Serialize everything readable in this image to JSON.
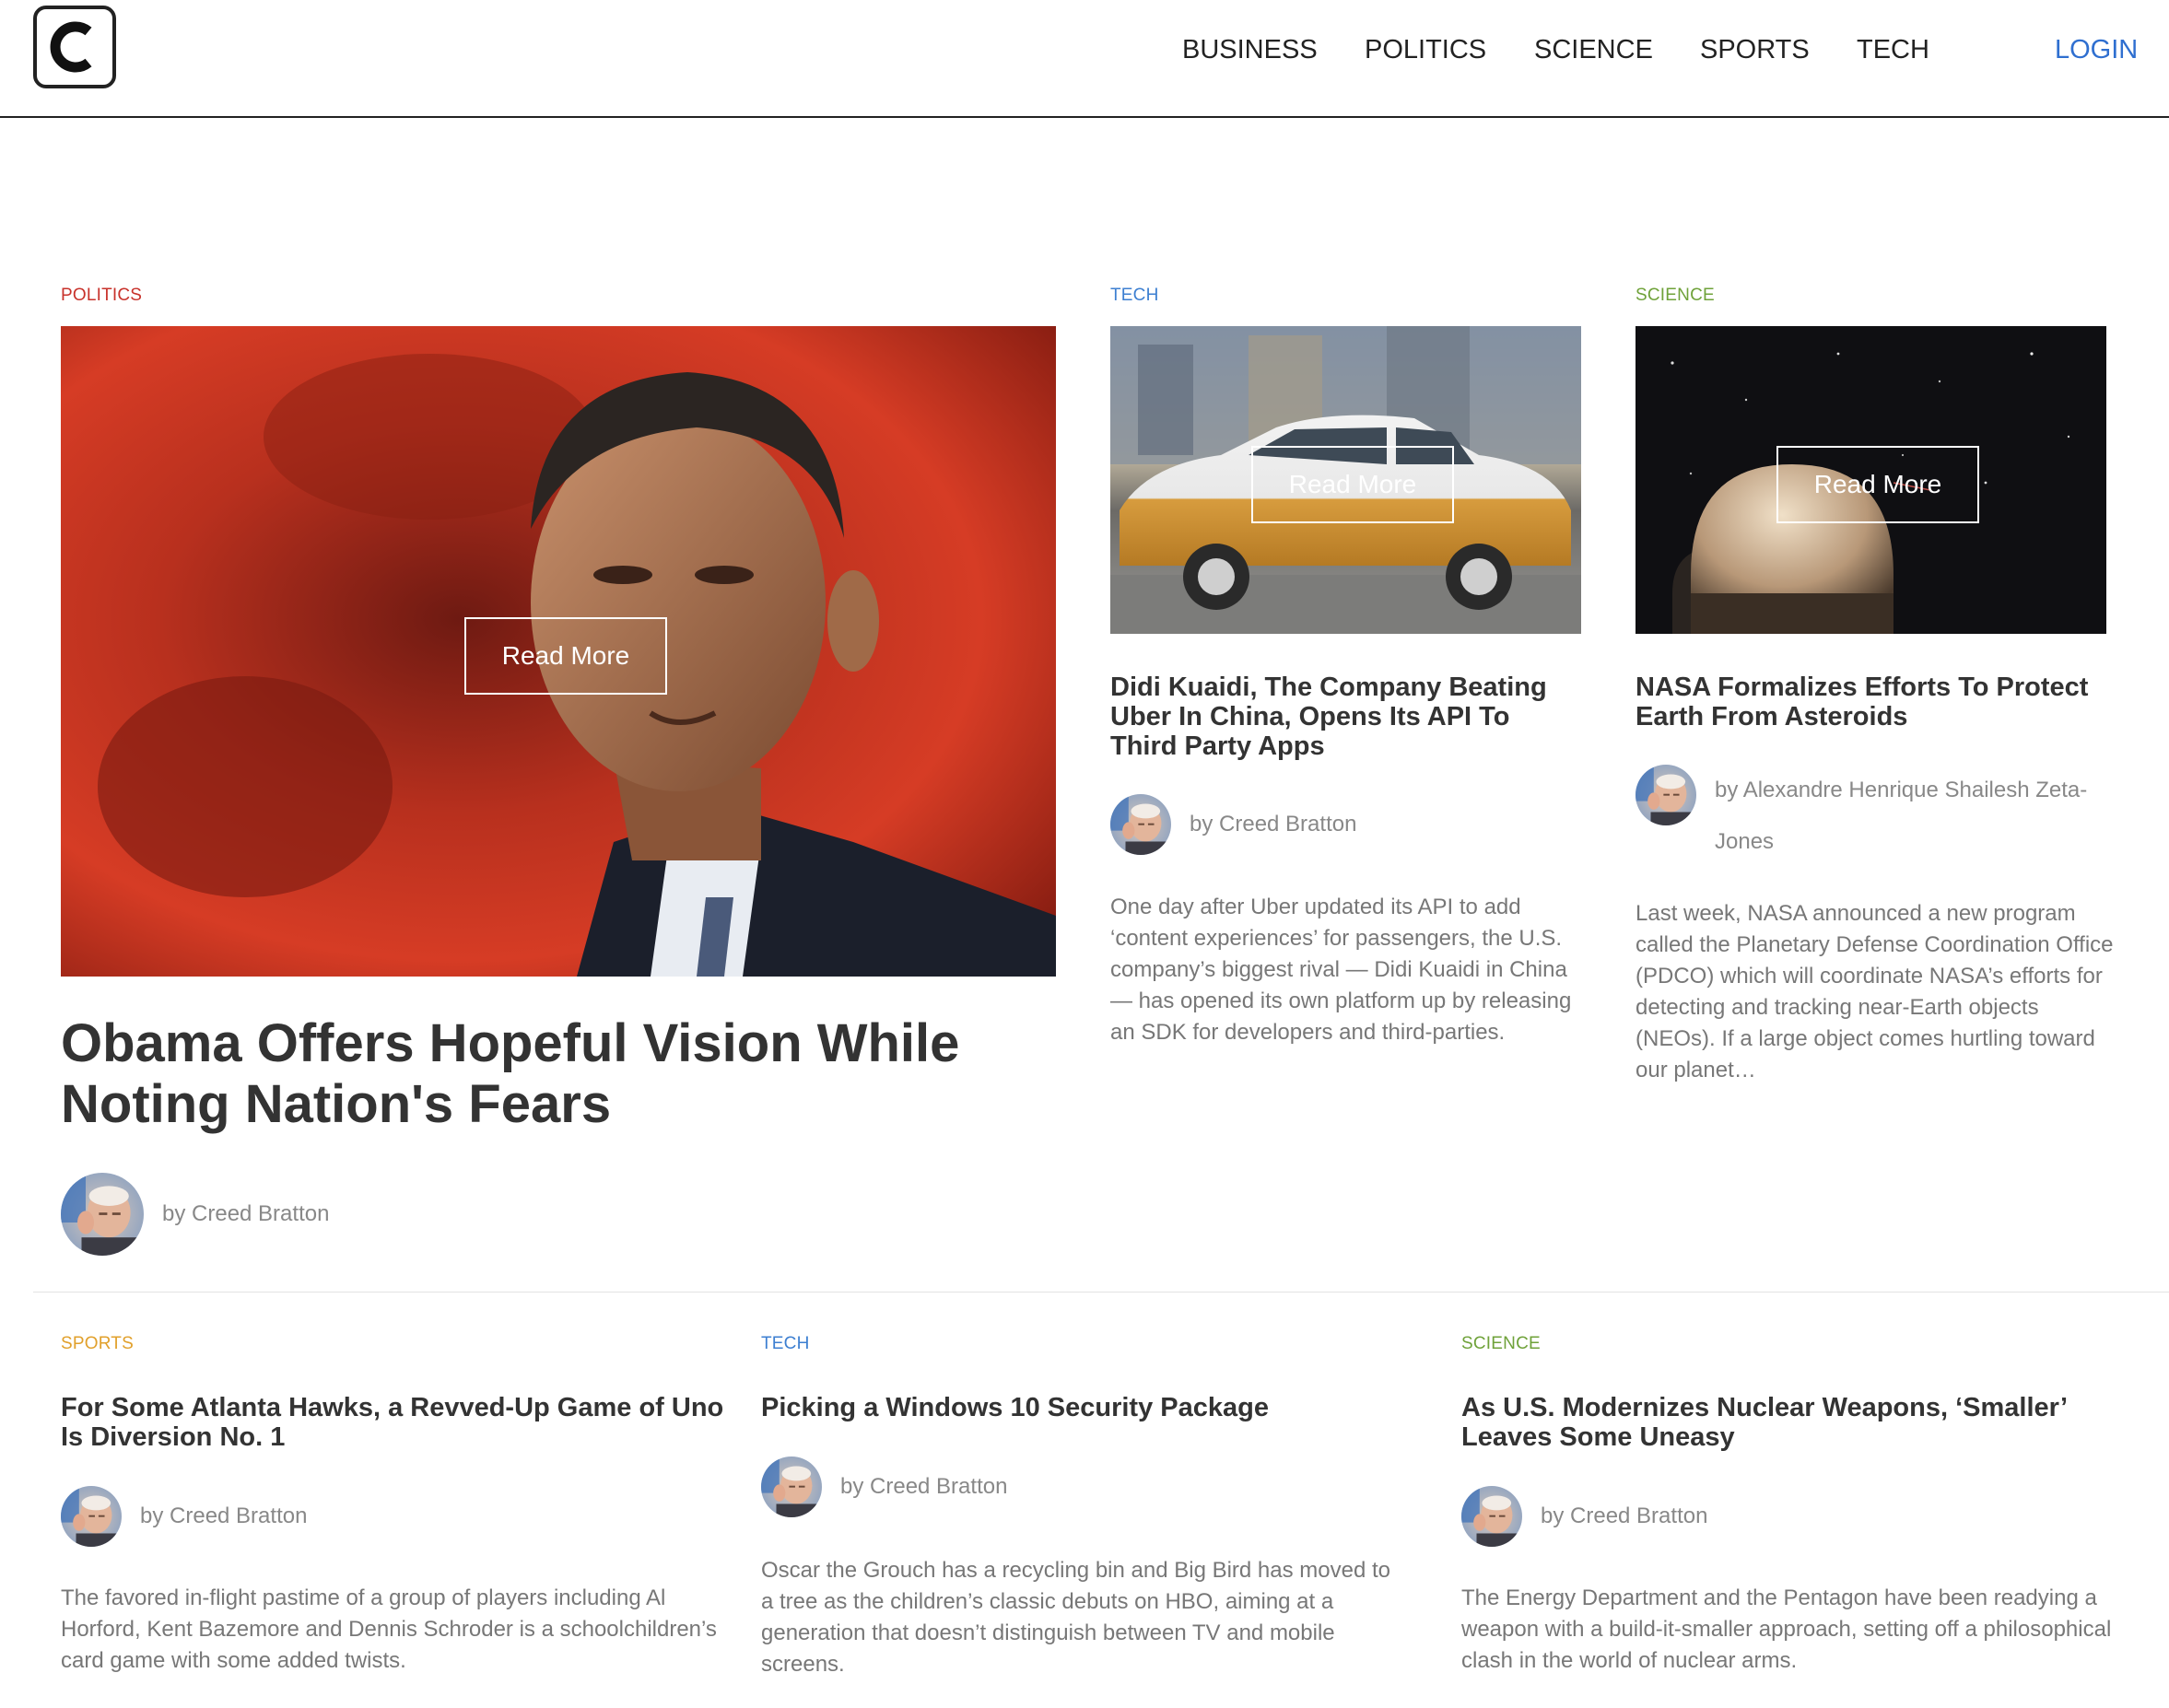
{
  "header": {
    "nav": [
      "BUSINESS",
      "POLITICS",
      "SCIENCE",
      "SPORTS",
      "TECH"
    ],
    "login": "LOGIN"
  },
  "featured": {
    "category": "POLITICS",
    "read_more": "Read More",
    "headline": "Obama Offers Hopeful Vision While Noting Nation's Fears",
    "byline": "by Creed Bratton"
  },
  "top_articles": [
    {
      "category": "TECH",
      "read_more": "Read More",
      "headline": "Didi Kuaidi, The Company Beating Uber In China, Opens Its API To Third Party Apps",
      "byline": "by Creed Bratton",
      "excerpt": "One day after Uber updated its API to add ‘content experiences’ for passengers, the U.S. company’s biggest rival — Didi Kuaidi in China — has opened its own platform up by releasing an SDK for developers and third-parties."
    },
    {
      "category": "SCIENCE",
      "read_more": "Read More",
      "headline": "NASA Formalizes Efforts To Protect Earth From Asteroids",
      "byline": "by Alexandre Henrique Shailesh Zeta-Jones",
      "excerpt": "Last week, NASA announced a new program called the Planetary Defense Coordination Office (PDCO) which will coordinate NASA’s efforts for detecting and tracking near-Earth objects (NEOs). If a large object comes hurtling toward our planet…"
    }
  ],
  "bottom_articles": [
    {
      "category": "SPORTS",
      "headline": "For Some Atlanta Hawks, a Revved-Up Game of Uno Is Diversion No. 1",
      "byline": "by Creed Bratton",
      "excerpt": "The favored in-flight pastime of a group of players including Al Horford, Kent Bazemore and Dennis Schroder is a schoolchildren’s card game with some added twists."
    },
    {
      "category": "TECH",
      "headline": "Picking a Windows 10 Security Package",
      "byline": "by Creed Bratton",
      "excerpt": "Oscar the Grouch has a recycling bin and Big Bird has moved to a tree as the children’s classic debuts on HBO, aiming at a generation that doesn’t distinguish between TV and mobile screens."
    },
    {
      "category": "SCIENCE",
      "headline": "As U.S. Modernizes Nuclear Weapons, ‘Smaller’ Leaves Some Uneasy",
      "byline": "by Creed Bratton",
      "excerpt": "The Energy Department and the Pentagon have been readying a weapon with a build-it-smaller approach, setting off a philosophical clash in the world of nuclear arms."
    }
  ],
  "colors": {
    "politics": "#c8322b",
    "tech": "#3d7fd1",
    "science": "#6fa23a",
    "sports": "#e1a02b",
    "login": "#2f6fd0"
  },
  "icons": {
    "logo": "letter-c-logo",
    "avatar": "author-avatar"
  }
}
